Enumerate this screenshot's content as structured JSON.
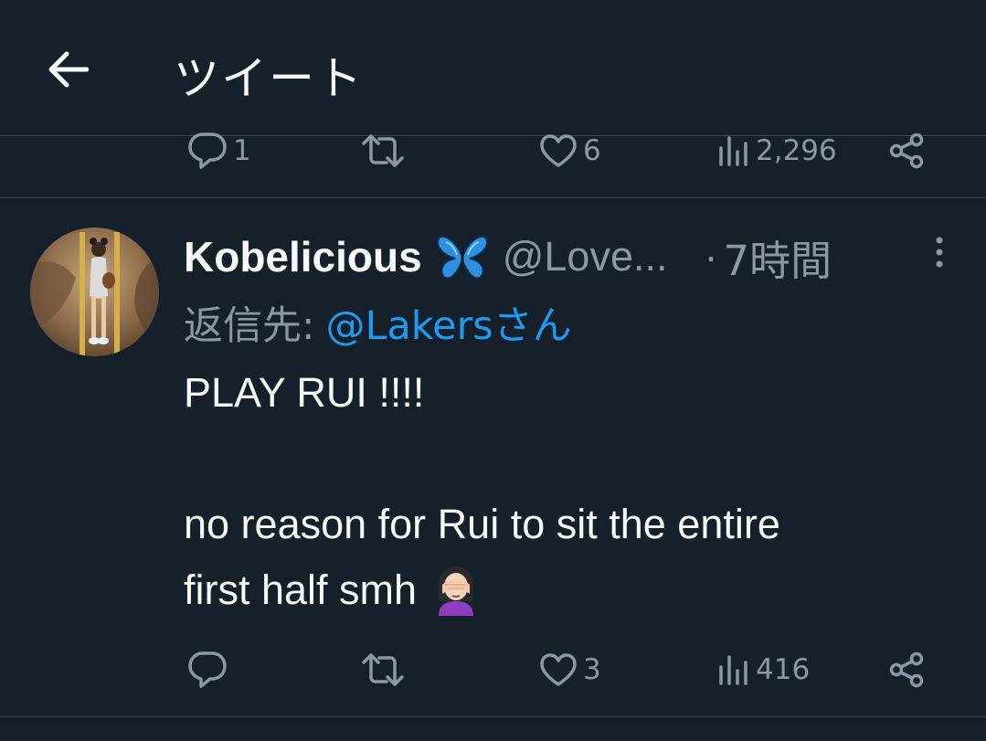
{
  "header": {
    "title": "ツイート"
  },
  "previous_tweet_actions": {
    "reply_count": "1",
    "retweet_count": "",
    "like_count": "6",
    "view_count": "2,296"
  },
  "tweet": {
    "display_name": "Kobelicious",
    "badge_emoji": "butterfly",
    "handle": "@Love...",
    "separator": "·",
    "time": "7時間",
    "reply_prefix": "返信先:",
    "reply_target": "@Lakersさん",
    "text_line1": "PLAY RUI !!!!",
    "text_line2": "no reason for Rui to sit the entire",
    "text_line3": "first half smh",
    "text_emoji": "woman-facepalming",
    "actions": {
      "reply_count": "",
      "retweet_count": "",
      "like_count": "3",
      "view_count": "416"
    }
  },
  "colors": {
    "background": "#15202b",
    "divider": "#38444d",
    "muted_text": "#8b98a5",
    "primary_text": "#f7f9f9",
    "link": "#1d9bf0"
  },
  "icons": {
    "back": "arrow-left-icon",
    "reply": "reply-icon",
    "retweet": "retweet-icon",
    "like": "heart-icon",
    "views": "views-icon",
    "share": "share-icon",
    "more": "more-vertical-icon"
  }
}
